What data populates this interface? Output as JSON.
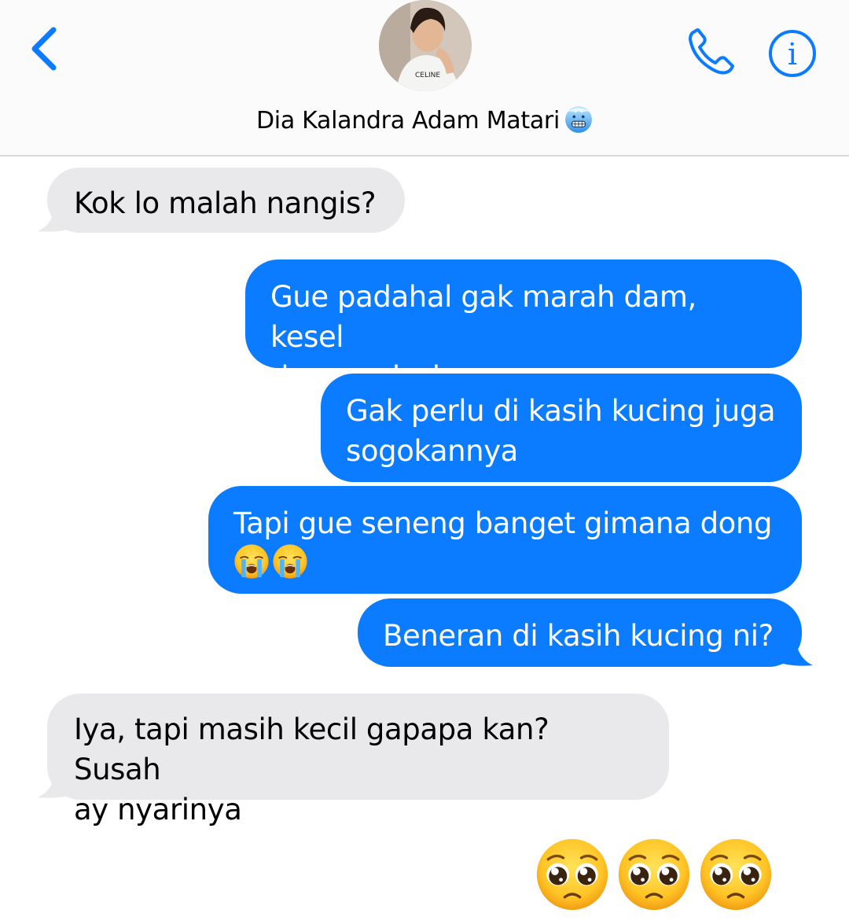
{
  "header": {
    "contact_name": "Dia Kalandra Adam Matari",
    "name_emoji": "cold-face-emoji",
    "back_icon": "chevron-left-icon",
    "call_icon": "phone-icon",
    "info_icon": "info-icon"
  },
  "messages": [
    {
      "side": "received",
      "text": "Kok lo malah nangis?"
    },
    {
      "side": "sent",
      "line1": "Gue padahal gak marah dam, kesel",
      "line2": "doang wkwk"
    },
    {
      "side": "sent",
      "line1": "Gak perlu di kasih kucing juga",
      "line2": "sogokannya"
    },
    {
      "side": "sent",
      "line1": "Tapi gue seneng banget gimana dong",
      "emojis": [
        "loudly-crying-face",
        "loudly-crying-face"
      ]
    },
    {
      "side": "sent",
      "text": "Beneran di kasih kucing ni?"
    },
    {
      "side": "received",
      "line1": "Iya, tapi masih kecil gapapa kan? Susah",
      "line2": "ay nyarinya"
    }
  ],
  "emoji_message": [
    "pleading-face",
    "pleading-face",
    "pleading-face"
  ],
  "colors": {
    "accent": "#0B7BFF",
    "received_bubble": "#E9E9EB",
    "sent_bubble": "#0B7BFF",
    "header_bg": "#FBFBFB"
  }
}
